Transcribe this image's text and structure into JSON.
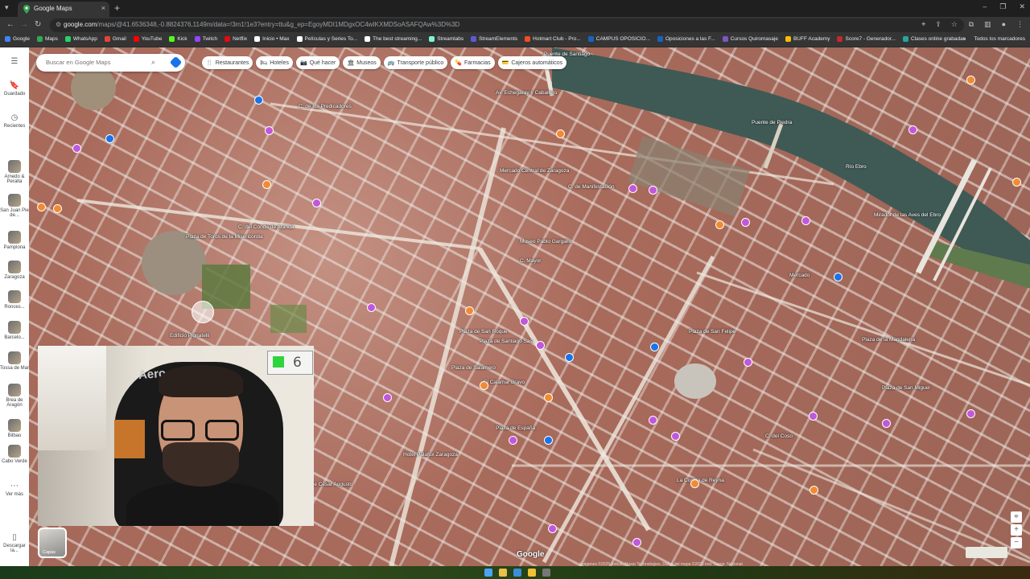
{
  "browser": {
    "tab_title": "Google Maps",
    "new_tab": "+",
    "tab_close": "×",
    "url_host": "google.com",
    "url_path": "/maps/@41.6536348,-0.8824376,1149m/data=!3m1!1e3?entry=ttu&g_ep=EgoyMDI1MDgxOC4wIKXMDSoASAFQAw%3D%3D",
    "window_controls": [
      "–",
      "❐",
      "✕"
    ]
  },
  "bookmarks": {
    "items": [
      {
        "label": "Google",
        "color": "#4285f4"
      },
      {
        "label": "Maps",
        "color": "#34a853"
      },
      {
        "label": "WhatsApp",
        "color": "#25d366"
      },
      {
        "label": "Gmail",
        "color": "#ea4335"
      },
      {
        "label": "YouTube",
        "color": "#ff0000"
      },
      {
        "label": "Kick",
        "color": "#53fc18"
      },
      {
        "label": "Twitch",
        "color": "#9146ff"
      },
      {
        "label": "Netflix",
        "color": "#e50914"
      },
      {
        "label": "Inicio • Max",
        "color": "#ffffff"
      },
      {
        "label": "Películas y Series To...",
        "color": "#ffffff"
      },
      {
        "label": "The best streaming...",
        "color": "#ffffff"
      },
      {
        "label": "Streamlabs",
        "color": "#80f5d2"
      },
      {
        "label": "StreamElements",
        "color": "#5b5bd6"
      },
      {
        "label": "Hotmart Club - Pro...",
        "color": "#f04e23"
      },
      {
        "label": "CAMPUS OPOSICIO...",
        "color": "#1565c0"
      },
      {
        "label": "Oposiciones a las F...",
        "color": "#1565c0"
      },
      {
        "label": "Cursos Quiromasaje",
        "color": "#7e57c2"
      },
      {
        "label": "BUFF Academy",
        "color": "#fbbc04"
      },
      {
        "label": "Score7 - Generador...",
        "color": "#c62828"
      },
      {
        "label": "Clases online grabadas",
        "color": "#26a69a"
      }
    ],
    "overflow": "»",
    "all_bookmarks": "Todos los marcadores"
  },
  "rail": {
    "menu_icon": "menu-icon",
    "saved": "Guardado",
    "recent": "Recientes",
    "places": [
      "Arnedo & Peralta",
      "San Juan Pie de...",
      "Pamplona",
      "Zaragoza",
      "Ronces...",
      "Barcelo...",
      "Tossa de Mar",
      "Brea de Aragón",
      "Bilbao",
      "Cabo Verde"
    ],
    "more": "Ver más",
    "download": "Descargar la..."
  },
  "search": {
    "placeholder": "Buscar en Google Maps"
  },
  "chips": [
    {
      "label": "Restaurantes",
      "icon": "🍴"
    },
    {
      "label": "Hoteles",
      "icon": "🛏"
    },
    {
      "label": "Qué hacer",
      "icon": "📷"
    },
    {
      "label": "Museos",
      "icon": "🏛"
    },
    {
      "label": "Transporte público",
      "icon": "🚌"
    },
    {
      "label": "Farmacias",
      "icon": "💊"
    },
    {
      "label": "Cajeros automáticos",
      "icon": "💳"
    }
  ],
  "map": {
    "labels": [
      "Puente de Santiago",
      "Puente de Piedra",
      "Río Ebro",
      "Mirador de las Aves del Ebro",
      "Mercado Central de Zaragoza",
      "Museo Pablo Gargallo",
      "Plaza de Toros de la Misericordia",
      "Plaza de San Felipe",
      "Mercado",
      "Plaza de la Magdalena",
      "Plaza de San Miguel",
      "Edificio Pignatelli",
      "Plaza de España",
      "El Calamar Bravo",
      "Hotel Palafox Zaragoza",
      "La Cocina de Reyna",
      "Plaza de Santiago Sas",
      "Plaza de Salamero",
      "Plaza de San Roque",
      "C. del Conde de Aranda",
      "C. de los Predicadores",
      "Av. de César Augusto",
      "C. de Manifestación",
      "C. Mayor",
      "C. del Coso",
      "Av. Echegaray y Caballero"
    ],
    "layers_label": "Capas",
    "google_logo": "Google",
    "attribution": "Imágenes ©2025 Airbus, Maxar Technologies, Datos del mapa ©2025 Inst. Geogr. Nacional"
  },
  "webcam": {
    "chair_brand": "Aero",
    "screen_number": "6"
  },
  "colors": {
    "pin_purple": "#c158dc",
    "pin_orange": "#f28b30",
    "pin_blue": "#1a73e8",
    "accent": "#1a73e8"
  }
}
